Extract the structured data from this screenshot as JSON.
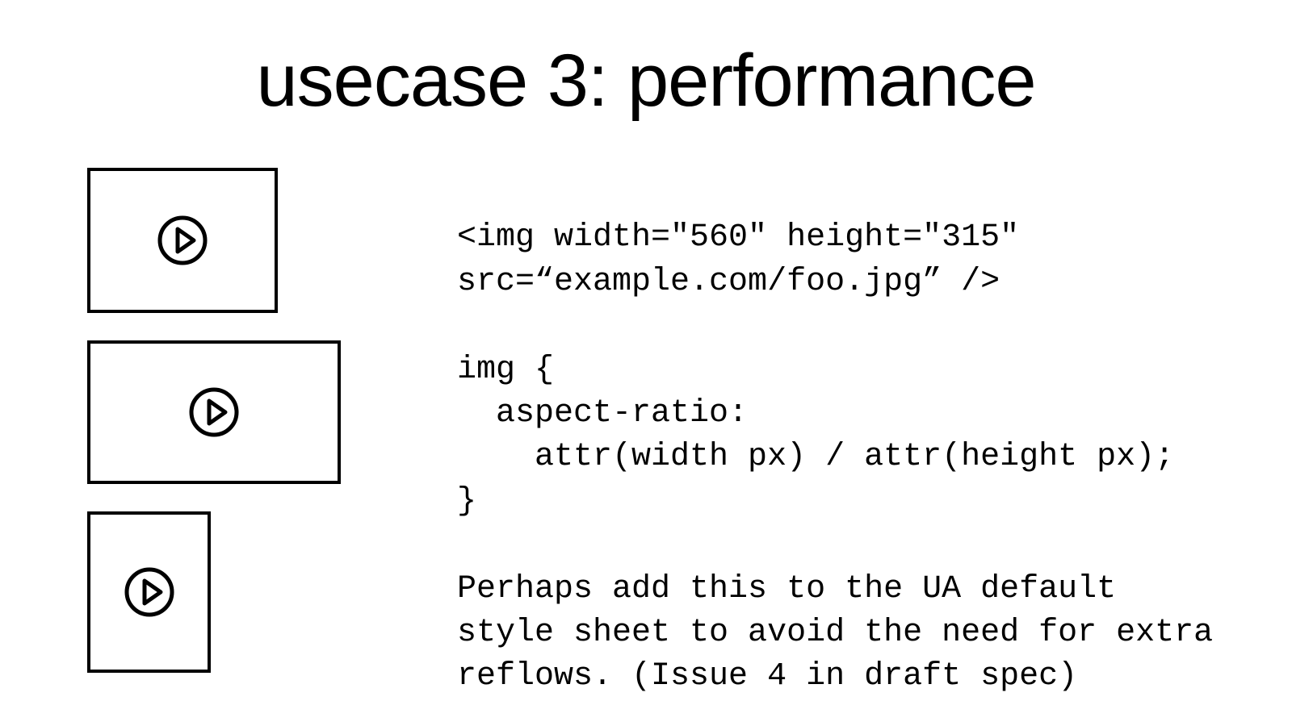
{
  "title": "usecase 3: performance",
  "code_line1": "<img width=\"560\" height=\"315\"",
  "code_line2": "src=“example.com/foo.jpg” />",
  "css_line1": "img {",
  "css_line2": "  aspect-ratio:",
  "css_line3": "    attr(width px) / attr(height px);",
  "css_line4": "}",
  "note": "Perhaps add this to the UA default style sheet to avoid the need for extra reflows. (Issue 4 in draft spec)",
  "boxes": [
    {
      "name": "media-placeholder-1"
    },
    {
      "name": "media-placeholder-2"
    },
    {
      "name": "media-placeholder-3"
    }
  ]
}
